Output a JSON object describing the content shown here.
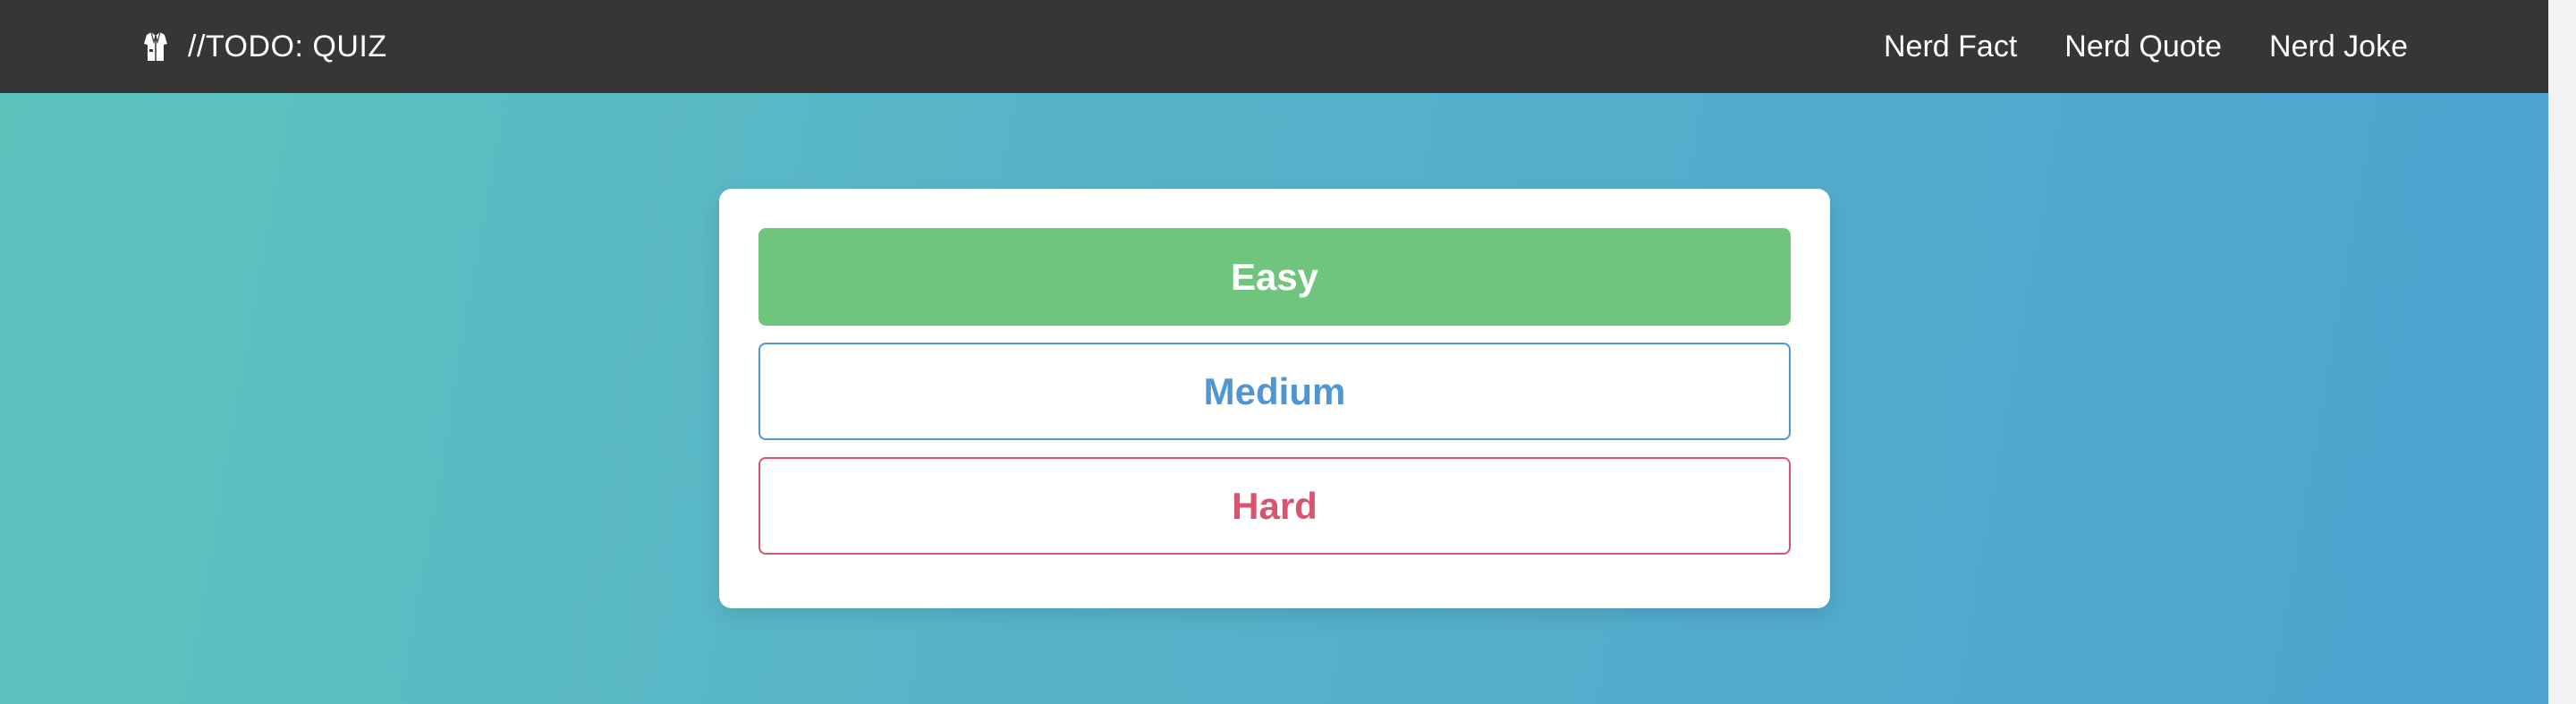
{
  "navbar": {
    "brand_icon": "lab-coat-icon",
    "brand_title": "//TODO: QUIZ",
    "links": [
      {
        "label": "Nerd Fact"
      },
      {
        "label": "Nerd Quote"
      },
      {
        "label": "Nerd Joke"
      }
    ]
  },
  "difficulty": {
    "options": [
      {
        "label": "Easy",
        "color": "#6fc57e",
        "style": "filled"
      },
      {
        "label": "Medium",
        "color": "#4f97d2",
        "style": "outline"
      },
      {
        "label": "Hard",
        "color": "#d9546e",
        "style": "outline"
      }
    ]
  },
  "colors": {
    "navbar_bg": "#363636",
    "background_gradient": [
      "#5ec3bd",
      "#4ea2d0"
    ]
  }
}
